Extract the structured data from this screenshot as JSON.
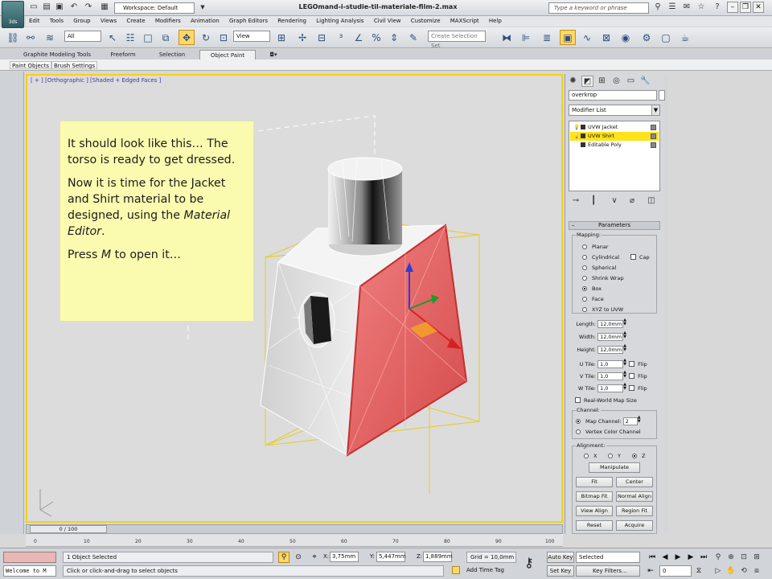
{
  "title_bar": {
    "app_logo_label": "3ds",
    "workspace_label": "Workspace: Default",
    "file_title": "LEGOmand-i-studie-til-materiale-film-2.max",
    "search_placeholder": "Type a keyword or phrase"
  },
  "menu": {
    "items": [
      "Edit",
      "Tools",
      "Group",
      "Views",
      "Create",
      "Modifiers",
      "Animation",
      "Graph Editors",
      "Rendering",
      "Lighting Analysis",
      "Civil View",
      "Customize",
      "MAXScript",
      "Help"
    ]
  },
  "toolbar": {
    "selection_filter": "All",
    "reference_coord": "View",
    "named_selection_placeholder": "Create Selection Set"
  },
  "ribbon": {
    "tabs": [
      "Graphite Modeling Tools",
      "Freeform",
      "Selection",
      "Object Paint"
    ],
    "active_tab": "Object Paint",
    "sub_buttons": [
      "Paint Objects",
      "Brush Settings"
    ]
  },
  "viewport": {
    "label": "[ + ] [Orthographic ] [Shaded + Edged Faces ]",
    "note": {
      "p1": "It should look like this… The torso is ready to get dressed.",
      "p2_start": "Now it is time for the Jacket and Shirt material to be designed, using the ",
      "p2_em": "Material Editor",
      "p2_end": ".",
      "p3_start": "Press ",
      "p3_em": "M",
      "p3_end": " to open it…"
    }
  },
  "command_panel": {
    "object_name": "overkrop",
    "modifier_list_label": "Modifier List",
    "stack": [
      {
        "label": "UVW Jacket",
        "selected": false
      },
      {
        "label": "UVW Shirt",
        "selected": true
      },
      {
        "label": "Editable Poly",
        "selected": false
      }
    ],
    "parameters_title": "Parameters",
    "mapping": {
      "title": "Mapping:",
      "options": [
        "Planar",
        "Cylindrical",
        "Spherical",
        "Shrink Wrap",
        "Box",
        "Face",
        "XYZ to UVW"
      ],
      "selected": "Box",
      "cap_label": "Cap"
    },
    "dimensions": [
      {
        "label": "Length:",
        "value": "12,0mm"
      },
      {
        "label": "Width:",
        "value": "12,0mm"
      },
      {
        "label": "Height:",
        "value": "12,0mm"
      }
    ],
    "tiles": [
      {
        "label": "U Tile:",
        "value": "1,0",
        "flip": "Flip"
      },
      {
        "label": "V Tile:",
        "value": "1,0",
        "flip": "Flip"
      },
      {
        "label": "W Tile:",
        "value": "1,0",
        "flip": "Flip"
      }
    ],
    "real_world_label": "Real-World Map Size",
    "channel": {
      "title": "Channel:",
      "map_channel_label": "Map Channel:",
      "map_channel_value": "2",
      "vertex_color_label": "Vertex Color Channel"
    },
    "alignment": {
      "title": "Alignment:",
      "axes": [
        "X",
        "Y",
        "Z"
      ],
      "selected_axis": "Z",
      "manipulate": "Manipulate",
      "buttons": [
        "Fit",
        "Center",
        "Bitmap Fit",
        "Normal Align",
        "View Align",
        "Region Fit",
        "Reset",
        "Acquire"
      ]
    }
  },
  "timeline": {
    "slider_label": "0 / 100",
    "ticks": [
      "0",
      "10",
      "20",
      "30",
      "40",
      "50",
      "60",
      "70",
      "80",
      "90",
      "100"
    ]
  },
  "status": {
    "maxscript_text": "Welcome to M",
    "selection_text": "1 Object Selected",
    "prompt_text": "Click or click-and-drag to select objects",
    "x_label": "X:",
    "x_value": "3,75mm",
    "y_label": "Y:",
    "y_value": "5,447mm",
    "z_label": "Z:",
    "z_value": "1,889mm",
    "grid_text": "Grid = 10,0mm",
    "add_time_tag": "Add Time Tag",
    "auto_key": "Auto Key",
    "set_key": "Set Key",
    "key_mode": "Selected",
    "key_filters": "Key Filters...",
    "frame_value": "0"
  },
  "colors": {
    "viewport_border": "#f2d21a",
    "note_background": "#fbfbb0",
    "shirt_red": "#e06060",
    "stack_selected": "#ffe31a"
  }
}
